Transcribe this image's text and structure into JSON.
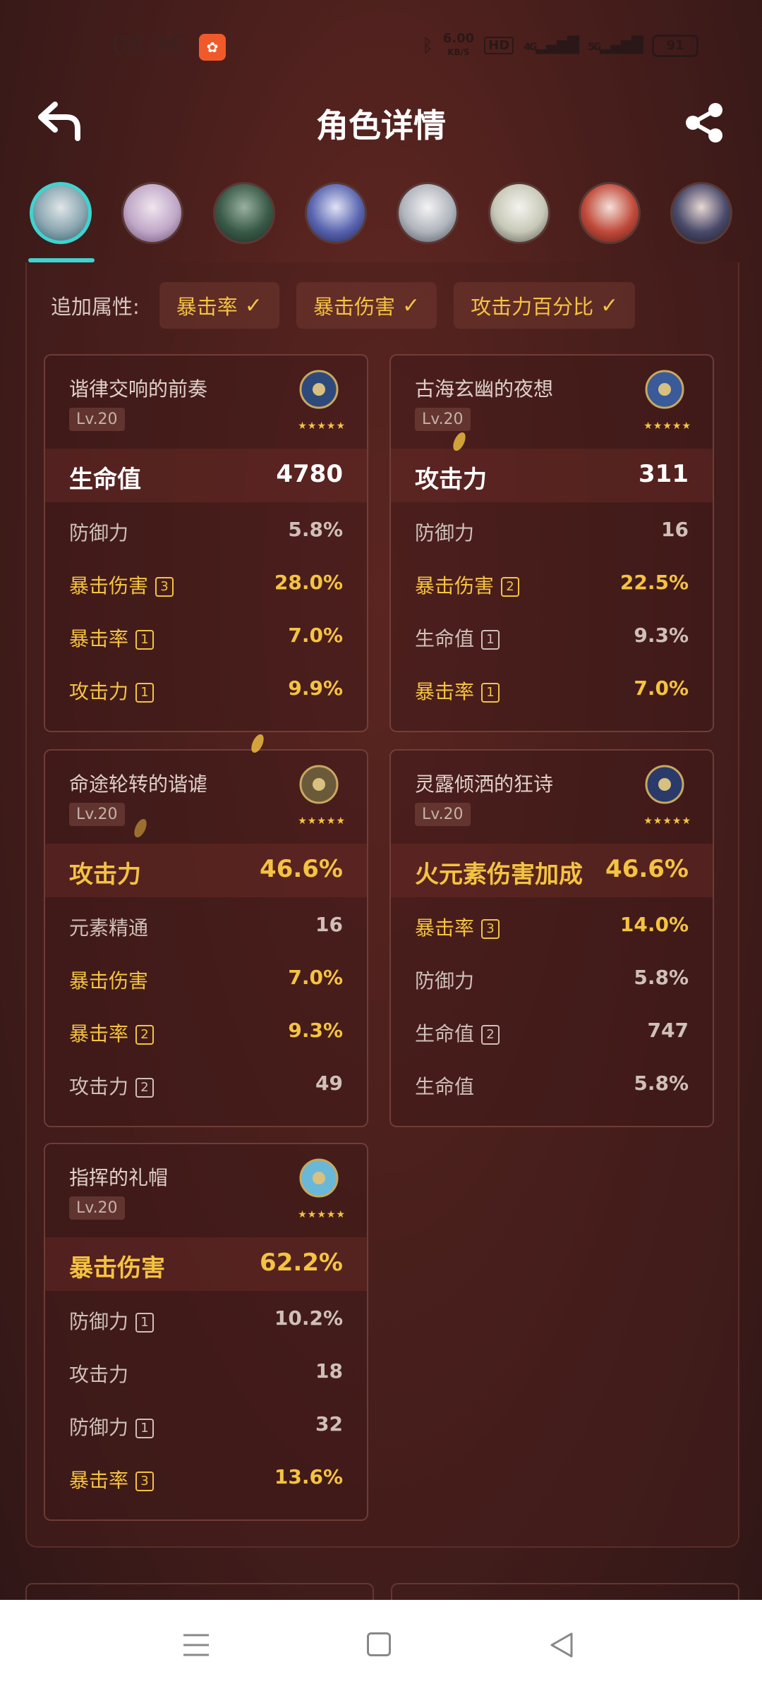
{
  "status_bar": {
    "time": "08:36",
    "speed": "6.00",
    "speed_unit": "KB/S",
    "hd": "HD",
    "net1": "4G",
    "net2": "5G",
    "battery": "91"
  },
  "header": {
    "title": "角色详情"
  },
  "bonus": {
    "label": "追加属性:",
    "chips": [
      "暴击率",
      "暴击伤害",
      "攻击力百分比"
    ]
  },
  "artifacts": [
    {
      "name": "谐律交响的前奏",
      "level": "Lv.20",
      "main": {
        "name": "生命值",
        "value": "4780"
      },
      "subs": [
        {
          "name": "防御力",
          "value": "5.8%",
          "badge": ""
        },
        {
          "name": "暴击伤害",
          "value": "28.0%",
          "badge": "3"
        },
        {
          "name": "暴击率",
          "value": "7.0%",
          "badge": "1"
        },
        {
          "name": "攻击力",
          "value": "9.9%",
          "badge": "1"
        }
      ]
    },
    {
      "name": "古海玄幽的夜想",
      "level": "Lv.20",
      "main": {
        "name": "攻击力",
        "value": "311"
      },
      "subs": [
        {
          "name": "防御力",
          "value": "16",
          "badge": ""
        },
        {
          "name": "暴击伤害",
          "value": "22.5%",
          "badge": "2"
        },
        {
          "name": "生命值",
          "value": "9.3%",
          "badge": "1"
        },
        {
          "name": "暴击率",
          "value": "7.0%",
          "badge": "1"
        }
      ]
    },
    {
      "name": "命途轮转的谐谑",
      "level": "Lv.20",
      "main": {
        "name": "攻击力",
        "value": "46.6%"
      },
      "subs": [
        {
          "name": "元素精通",
          "value": "16",
          "badge": ""
        },
        {
          "name": "暴击伤害",
          "value": "7.0%",
          "badge": ""
        },
        {
          "name": "暴击率",
          "value": "9.3%",
          "badge": "2"
        },
        {
          "name": "攻击力",
          "value": "49",
          "badge": "2"
        }
      ]
    },
    {
      "name": "灵露倾洒的狂诗",
      "level": "Lv.20",
      "main": {
        "name": "火元素伤害加成",
        "value": "46.6%"
      },
      "subs": [
        {
          "name": "暴击率",
          "value": "14.0%",
          "badge": "3"
        },
        {
          "name": "防御力",
          "value": "5.8%",
          "badge": ""
        },
        {
          "name": "生命值",
          "value": "747",
          "badge": "2"
        },
        {
          "name": "生命值",
          "value": "5.8%",
          "badge": ""
        }
      ]
    },
    {
      "name": "指挥的礼帽",
      "level": "Lv.20",
      "main": {
        "name": "暴击伤害",
        "value": "62.2%"
      },
      "subs": [
        {
          "name": "防御力",
          "value": "10.2%",
          "badge": "1"
        },
        {
          "name": "攻击力",
          "value": "18",
          "badge": ""
        },
        {
          "name": "防御力",
          "value": "32",
          "badge": "1"
        },
        {
          "name": "暴击率",
          "value": "13.6%",
          "badge": "3"
        }
      ]
    }
  ],
  "stars": "★★★★★",
  "colors": {
    "gold": "#f4c342",
    "accent": "#3ed4d0",
    "bg": "#4a1f1c"
  }
}
